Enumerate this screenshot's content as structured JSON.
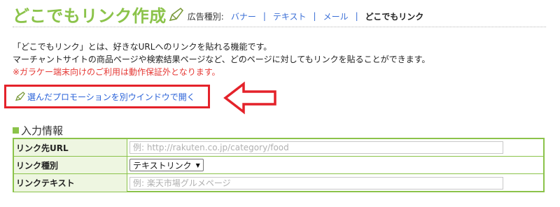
{
  "header": {
    "title": "どこでもリンク作成",
    "ad_type_label": "広告種別:",
    "ad_types": [
      "バナー",
      "テキスト",
      "メール"
    ],
    "current_ad_type": "どこでもリンク",
    "separator": "|"
  },
  "description": {
    "line1": "「どこでもリンク」とは、好きなURLへのリンクを貼れる機能です。",
    "line2": "マーチャントサイトの商品ページや検索結果ページなど、どのページに対してもリンクを貼ることができます。",
    "warning": "※ガラケー端末向けのご利用は動作保証外となります。"
  },
  "promo": {
    "link_label": "選んだプロモーションを別ウインドウで開く"
  },
  "section": {
    "title": "入力情報"
  },
  "form": {
    "url_label": "リンク先URL",
    "url_placeholder": "例: http://rakuten.co.jp/category/food",
    "type_label": "リンク種別",
    "type_selected": "テキストリンク",
    "text_label": "リンクテキスト",
    "text_placeholder": "例: 楽天市場グルメページ"
  },
  "colors": {
    "accent_green": "#8bc34a",
    "link_blue": "#2a62d8",
    "warning_red": "#e53935",
    "highlight_red": "#e4222a"
  },
  "icons": {
    "pen": "pen-icon",
    "arrow": "left-arrow-icon"
  }
}
